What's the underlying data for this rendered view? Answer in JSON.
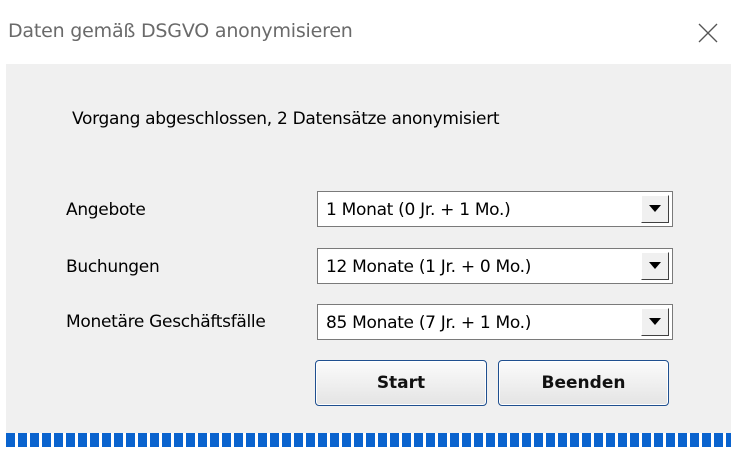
{
  "window": {
    "title": "Daten gemäß DSGVO anonymisieren"
  },
  "status": {
    "message": "Vorgang abgeschlossen, 2 Datensätze anonymisiert"
  },
  "rows": [
    {
      "label": "Angebote",
      "value": "1 Monat (0 Jr. + 1 Mo.)"
    },
    {
      "label": "Buchungen",
      "value": "12 Monate (1 Jr. + 0 Mo.)"
    },
    {
      "label": "Monetäre Geschäftsfälle",
      "value": "85 Monate (7 Jr. + 1 Mo.)"
    }
  ],
  "buttons": {
    "start": "Start",
    "close": "Beenden"
  },
  "progress": {
    "percent": 100,
    "color": "#0a63ce"
  },
  "icons": {
    "close": "close-icon",
    "dropdown": "chevron-down-icon"
  }
}
